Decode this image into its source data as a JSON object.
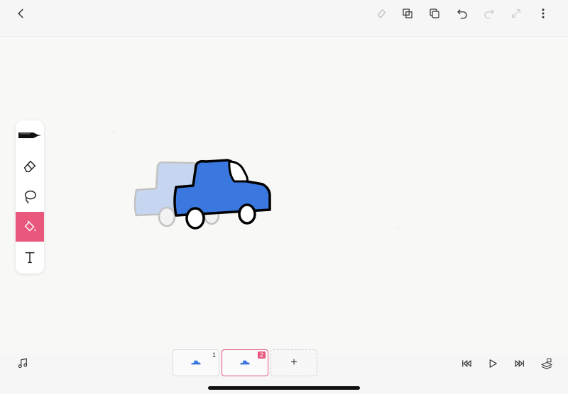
{
  "toolbar": {
    "back_icon": "chevron-left-icon",
    "actions": [
      "eraser-all-icon",
      "copy-frame-icon",
      "layers-icon",
      "undo-icon",
      "redo-icon",
      "resize-icon",
      "more-icon"
    ]
  },
  "tools": [
    {
      "name": "pen",
      "icon": "pen-icon",
      "active": false
    },
    {
      "name": "eraser",
      "icon": "eraser-icon",
      "active": false
    },
    {
      "name": "lasso",
      "icon": "lasso-icon",
      "active": false
    },
    {
      "name": "fill",
      "icon": "paint-bucket-icon",
      "active": true
    },
    {
      "name": "text",
      "icon": "text-icon",
      "active": false
    }
  ],
  "frames": [
    {
      "number": "1",
      "selected": false
    },
    {
      "number": "2",
      "selected": true
    }
  ],
  "add_frame_label": "+",
  "colors": {
    "accent": "#e9577d",
    "car_fill": "#3a78e0",
    "onion_skin": "#c7d6f0"
  }
}
